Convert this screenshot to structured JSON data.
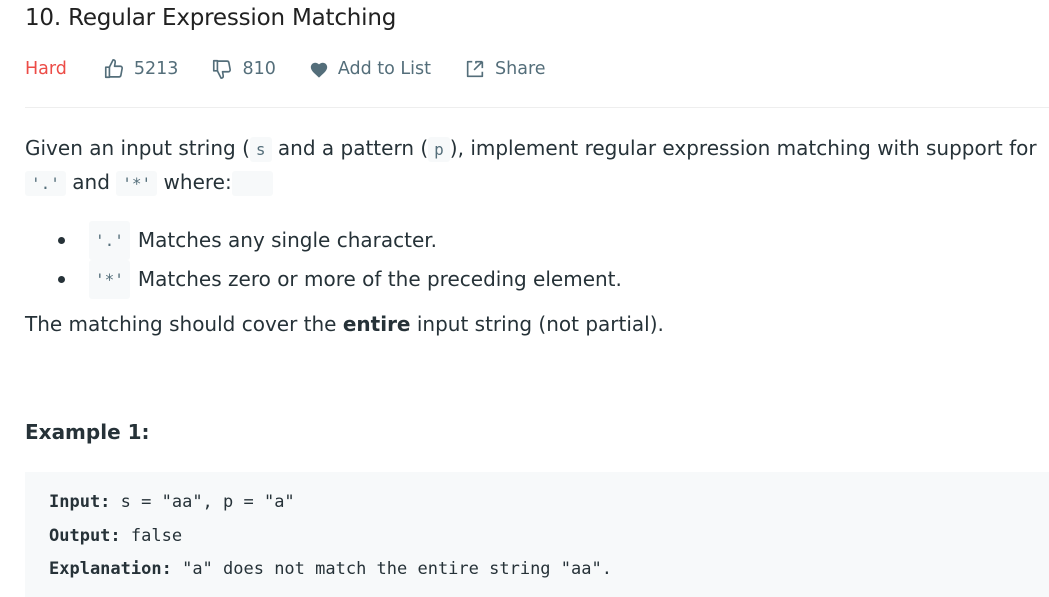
{
  "problem": {
    "title": "10. Regular Expression Matching",
    "difficulty": "Hard",
    "likes": "5213",
    "dislikes": "810",
    "add_to_list": "Add to List",
    "share": "Share"
  },
  "description": {
    "intro_a": "Given an input string (",
    "code_s": "s",
    "intro_b": "), implement regular expression matching with support for",
    "intro_b2": "and a pattern (",
    "code_p": "p",
    "code_dot": "'.'",
    "and_word": "and",
    "code_star": "'*'",
    "where": "where:",
    "bullets": [
      {
        "code": "'.'",
        "text": "Matches any single character."
      },
      {
        "code": "'*'",
        "text": "Matches zero or more of the preceding element."
      }
    ],
    "cover_a": "The matching should cover the",
    "cover_bold": "entire",
    "cover_b": "input string (not partial)."
  },
  "example1": {
    "heading": "Example 1:",
    "input_label": "Input:",
    "input_value": "s = \"aa\", p = \"a\"",
    "output_label": "Output:",
    "output_value": "false",
    "explanation_label": "Explanation:",
    "explanation_value": "\"a\" does not match the entire string \"aa\"."
  },
  "colors": {
    "hard": "#ec4c47",
    "muted": "#546e7a",
    "code_bg": "#f7f9fa"
  }
}
